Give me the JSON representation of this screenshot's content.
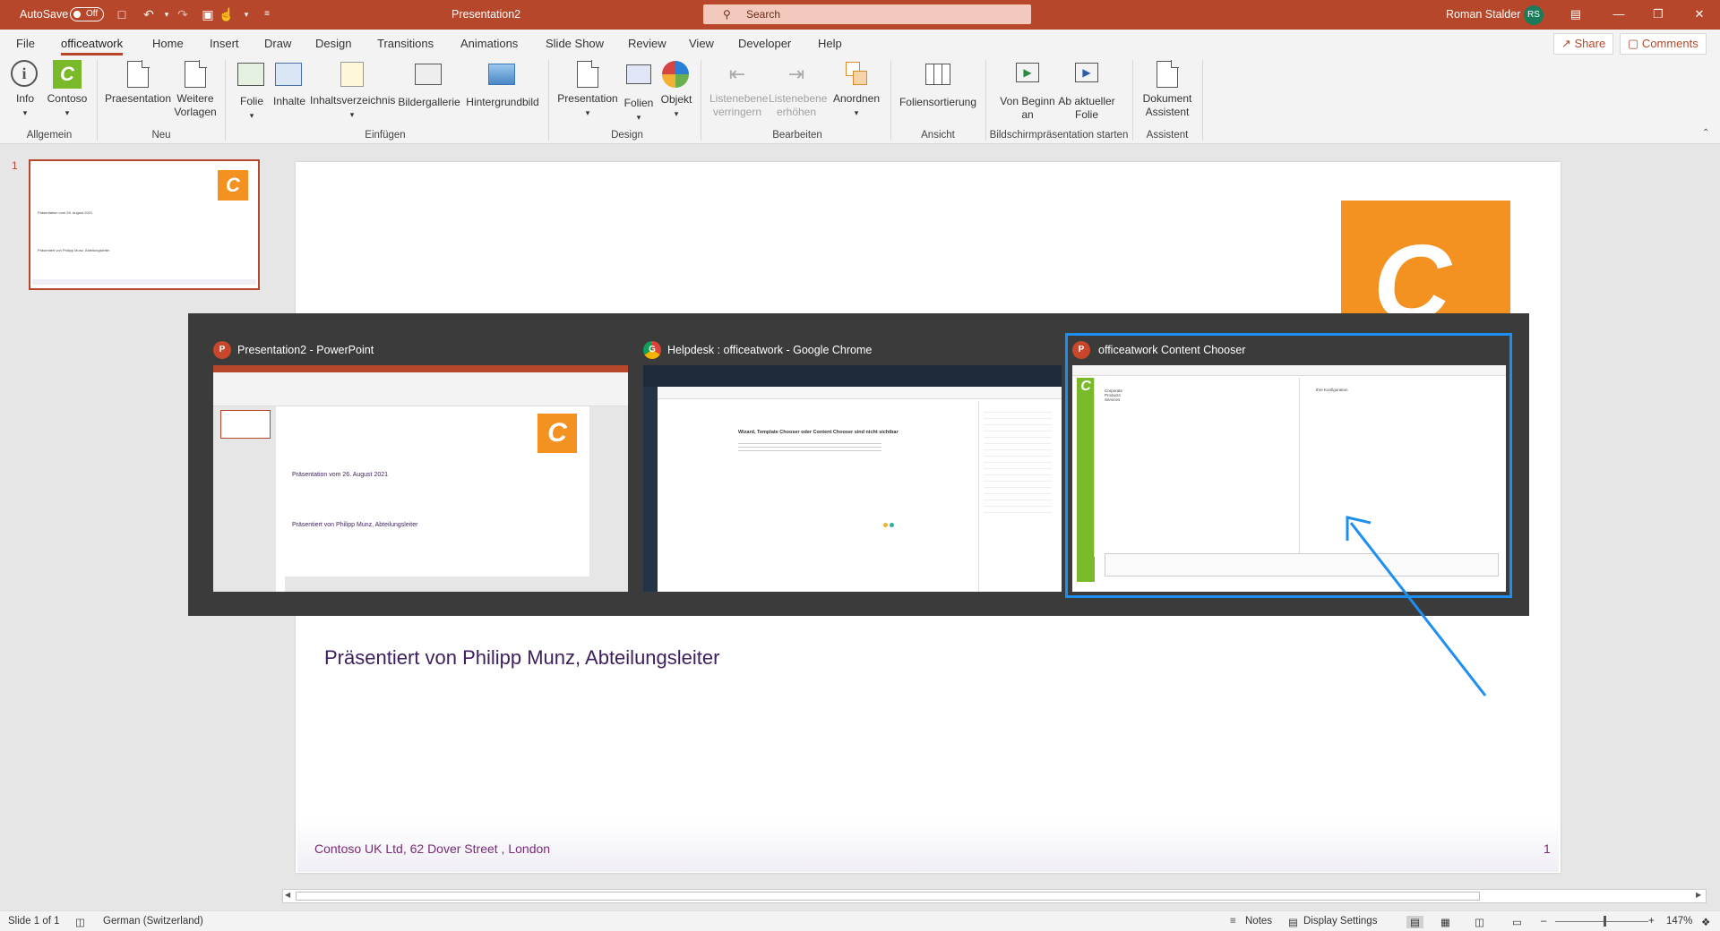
{
  "titlebar": {
    "autosave_label": "AutoSave",
    "autosave_state": "Off",
    "doc_title": "Presentation2",
    "search_placeholder": "Search",
    "user_name": "Roman Stalder",
    "user_initials": "RS"
  },
  "tabs": [
    "File",
    "officeatwork",
    "Home",
    "Insert",
    "Draw",
    "Design",
    "Transitions",
    "Animations",
    "Slide Show",
    "Review",
    "View",
    "Developer",
    "Help"
  ],
  "active_tab": "officeatwork",
  "share_label": "Share",
  "comments_label": "Comments",
  "ribbon": {
    "groups": {
      "allgemein": {
        "label": "Allgemein",
        "items": [
          "Info",
          "Contoso"
        ]
      },
      "neu": {
        "label": "Neu",
        "items": [
          "Praesentation",
          "Weitere Vorlagen"
        ]
      },
      "einfuegen": {
        "label": "Einfügen",
        "items": [
          "Folie",
          "Inhalte",
          "Inhaltsverzeichnis",
          "Bildergallerie",
          "Hintergrundbild"
        ]
      },
      "design": {
        "label": "Design",
        "items": [
          "Presentation",
          "Folien",
          "Objekt"
        ]
      },
      "bearbeiten": {
        "label": "Bearbeiten",
        "items": [
          "Listenebene verringern",
          "Listenebene erhöhen",
          "Anordnen"
        ]
      },
      "ansicht": {
        "label": "Ansicht",
        "items": [
          "Foliensortierung"
        ]
      },
      "bildschirm": {
        "label": "Bildschirmpräsentation starten",
        "items": [
          "Von Beginn an",
          "Ab aktueller Folie"
        ]
      },
      "assistent": {
        "label": "Assistent",
        "items": [
          "Dokument Assistent"
        ]
      }
    }
  },
  "thumbnails": [
    {
      "number": "1",
      "title_line": "Präsentation vom 26. August 2021",
      "presenter_line": "Präsentiert von Philipp Munz, Abteilungsleiter"
    }
  ],
  "slide": {
    "logo_letter": "C",
    "presenter": "Präsentiert von Philipp Munz, Abteilungsleiter",
    "footer": "Contoso UK Ltd, 62 Dover Street , London",
    "page_number": "1"
  },
  "switcher": {
    "windows": [
      {
        "title": "Presentation2 - PowerPoint",
        "app": "P"
      },
      {
        "title": "Helpdesk : officeatwork - Google Chrome",
        "app": "G"
      },
      {
        "title": "officeatwork Content Chooser",
        "app": "P"
      }
    ],
    "selected_index": 2,
    "preview_texts": {
      "ppt_line1": "Präsentation vom 26. August 2021",
      "ppt_line2": "Präsentiert von Philipp Munz, Abteilungsleiter",
      "chrome_heading": "Wizard, Template Chooser oder Content Chooser sind nicht sichtbar",
      "chooser_side": "Contoso",
      "chooser_tree": [
        "Corporate",
        "Products",
        "Services"
      ],
      "chooser_right_item": "Ihre Konfiguration"
    }
  },
  "statusbar": {
    "slide_info": "Slide 1 of 1",
    "language": "German (Switzerland)",
    "notes": "Notes",
    "display_settings": "Display Settings",
    "zoom": "147%"
  },
  "colors": {
    "accent": "#b7472a",
    "logo": "#f39221",
    "selection": "#1d8ff0",
    "presenter_text": "#3d1e5c"
  }
}
